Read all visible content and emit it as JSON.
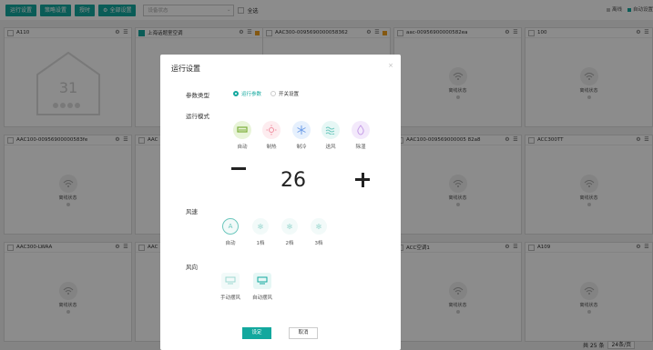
{
  "toolbar": {
    "buttons": [
      "运行设置",
      "策略设置",
      "授时",
      "全部设置"
    ],
    "select_placeholder": "设备状态",
    "select_all": "全选"
  },
  "legend": {
    "offline": "离线",
    "auto": "自动设置"
  },
  "colors": {
    "accent": "#13a89e",
    "flag": "#f0a020",
    "overlay": "rgba(0,0,0,0.45)"
  },
  "cards": [
    {
      "name": "A110",
      "status": ""
    },
    {
      "name": "上海话题室空调",
      "status": ""
    },
    {
      "name": "AAC300-0095690000058362",
      "status": ""
    },
    {
      "name": "aac-00956900000582ea",
      "status": "离线状态"
    },
    {
      "name": "100",
      "status": "离线状态"
    },
    {
      "name": "AAC100-00956900000583fe",
      "status": "离线状态"
    },
    {
      "name": "AAC",
      "status": ""
    },
    {
      "name": "AAC100-009569000005 82a8",
      "status": "离线状态"
    },
    {
      "name": "ACC300TT",
      "status": "离线状态"
    },
    {
      "name": "AAC300-LWAA",
      "status": "离线状态"
    },
    {
      "name": "AAC",
      "status": ""
    },
    {
      "name": "ACC空调1",
      "status": "离线状态"
    },
    {
      "name": "A109",
      "status": "离线状态"
    }
  ],
  "card_panel_display": "31",
  "modal": {
    "title": "运行设置",
    "close": "×",
    "param_type_label": "参数类型",
    "param_options": [
      "运行参数",
      "开关设置"
    ],
    "mode_label": "运行模式",
    "modes": [
      "自动",
      "制热",
      "制冷",
      "送风",
      "除湿"
    ],
    "temperature": "26",
    "fan_label": "风速",
    "fan_speeds": [
      "自动",
      "1档",
      "2档",
      "3档"
    ],
    "swing_label": "风向",
    "swings": [
      "手动摆风",
      "自动摆风"
    ],
    "confirm": "设定",
    "cancel": "取消"
  },
  "pager": {
    "total": "共 25 条",
    "page_size": "24条/页"
  }
}
